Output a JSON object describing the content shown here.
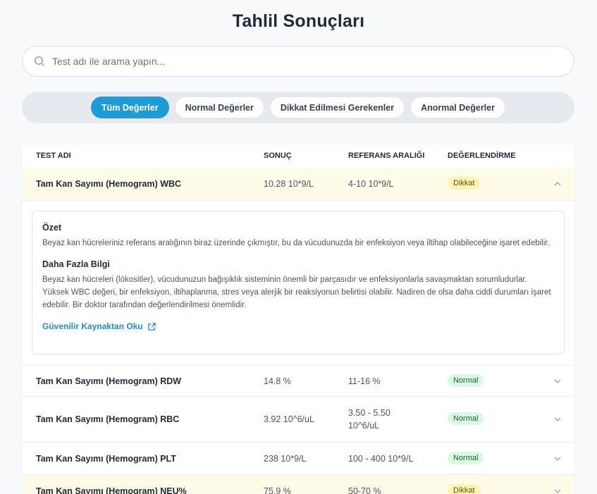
{
  "page": {
    "title": "Tahlil Sonuçları"
  },
  "search": {
    "placeholder": "Test adı ile arama yapın..."
  },
  "filters": [
    {
      "label": "Tüm Değerler",
      "active": true
    },
    {
      "label": "Normal Değerler",
      "active": false
    },
    {
      "label": "Dikkat Edilmesi Gerekenler",
      "active": false
    },
    {
      "label": "Anormal Değerler",
      "active": false
    }
  ],
  "table": {
    "headers": {
      "name": "TEST ADI",
      "result": "SONUÇ",
      "ref": "REFERANS ARALIĞI",
      "eval": "DEĞERLENDİRME"
    },
    "rows": [
      {
        "name": "Tam Kan Sayımı (Hemogram) WBC",
        "result": "10.28 10*9/L",
        "ref": "4-10 10*9/L",
        "eval": "Dikkat"
      },
      {
        "name": "Tam Kan Sayımı (Hemogram) RDW",
        "result": "14.8 %",
        "ref": "11-16 %",
        "eval": "Normal"
      },
      {
        "name": "Tam Kan Sayımı (Hemogram) RBC",
        "result": "3.92 10^6/uL",
        "ref_line1": "3.50 - 5.50",
        "ref_line2": "10^6/uL",
        "eval": "Normal"
      },
      {
        "name": "Tam Kan Sayımı (Hemogram) PLT",
        "result": "238 10*9/L",
        "ref": "100 - 400 10*9/L",
        "eval": "Normal"
      },
      {
        "name": "Tam Kan Sayımı (Hemogram) NEU%",
        "result": "75.9 %",
        "ref": "50-70 %",
        "eval": "Dikkat"
      }
    ]
  },
  "detail": {
    "summary_title": "Özet",
    "summary_text": "Beyaz kan hücreleriniz referans aralığının biraz üzerinde çıkmıştır, bu da vücudunuzda bir enfeksiyon veya iltihap olabileceğine işaret edebilir.",
    "more_title": "Daha Fazla Bilgi",
    "more_text": "Beyaz kan hücreleri (lökositler), vücudunuzun bağışıklık sisteminin önemli bir parçasıdır ve enfeksiyonlarla savaşmaktan sorumludurlar. Yüksek WBC değeri, bir enfeksiyon, iltihaplanma, stres veya alerjik bir reaksiyonun belirtisi olabilir. Nadiren de olsa daha ciddi durumları işaret edebilir. Bir doktor tarafından değerlendirilmesi önemlidir.",
    "link_label": "Güvenilir Kaynaktan Oku"
  },
  "icons": {
    "search": "search-icon",
    "chevron_up": "chevron-up-icon",
    "chevron_down": "chevron-down-icon",
    "external": "external-link-icon"
  },
  "colors": {
    "accent": "#1d9bd7",
    "warn_row": "#fefce8",
    "dikkat_badge": "#fdf3b4",
    "normal_badge": "#dcf7e3"
  }
}
